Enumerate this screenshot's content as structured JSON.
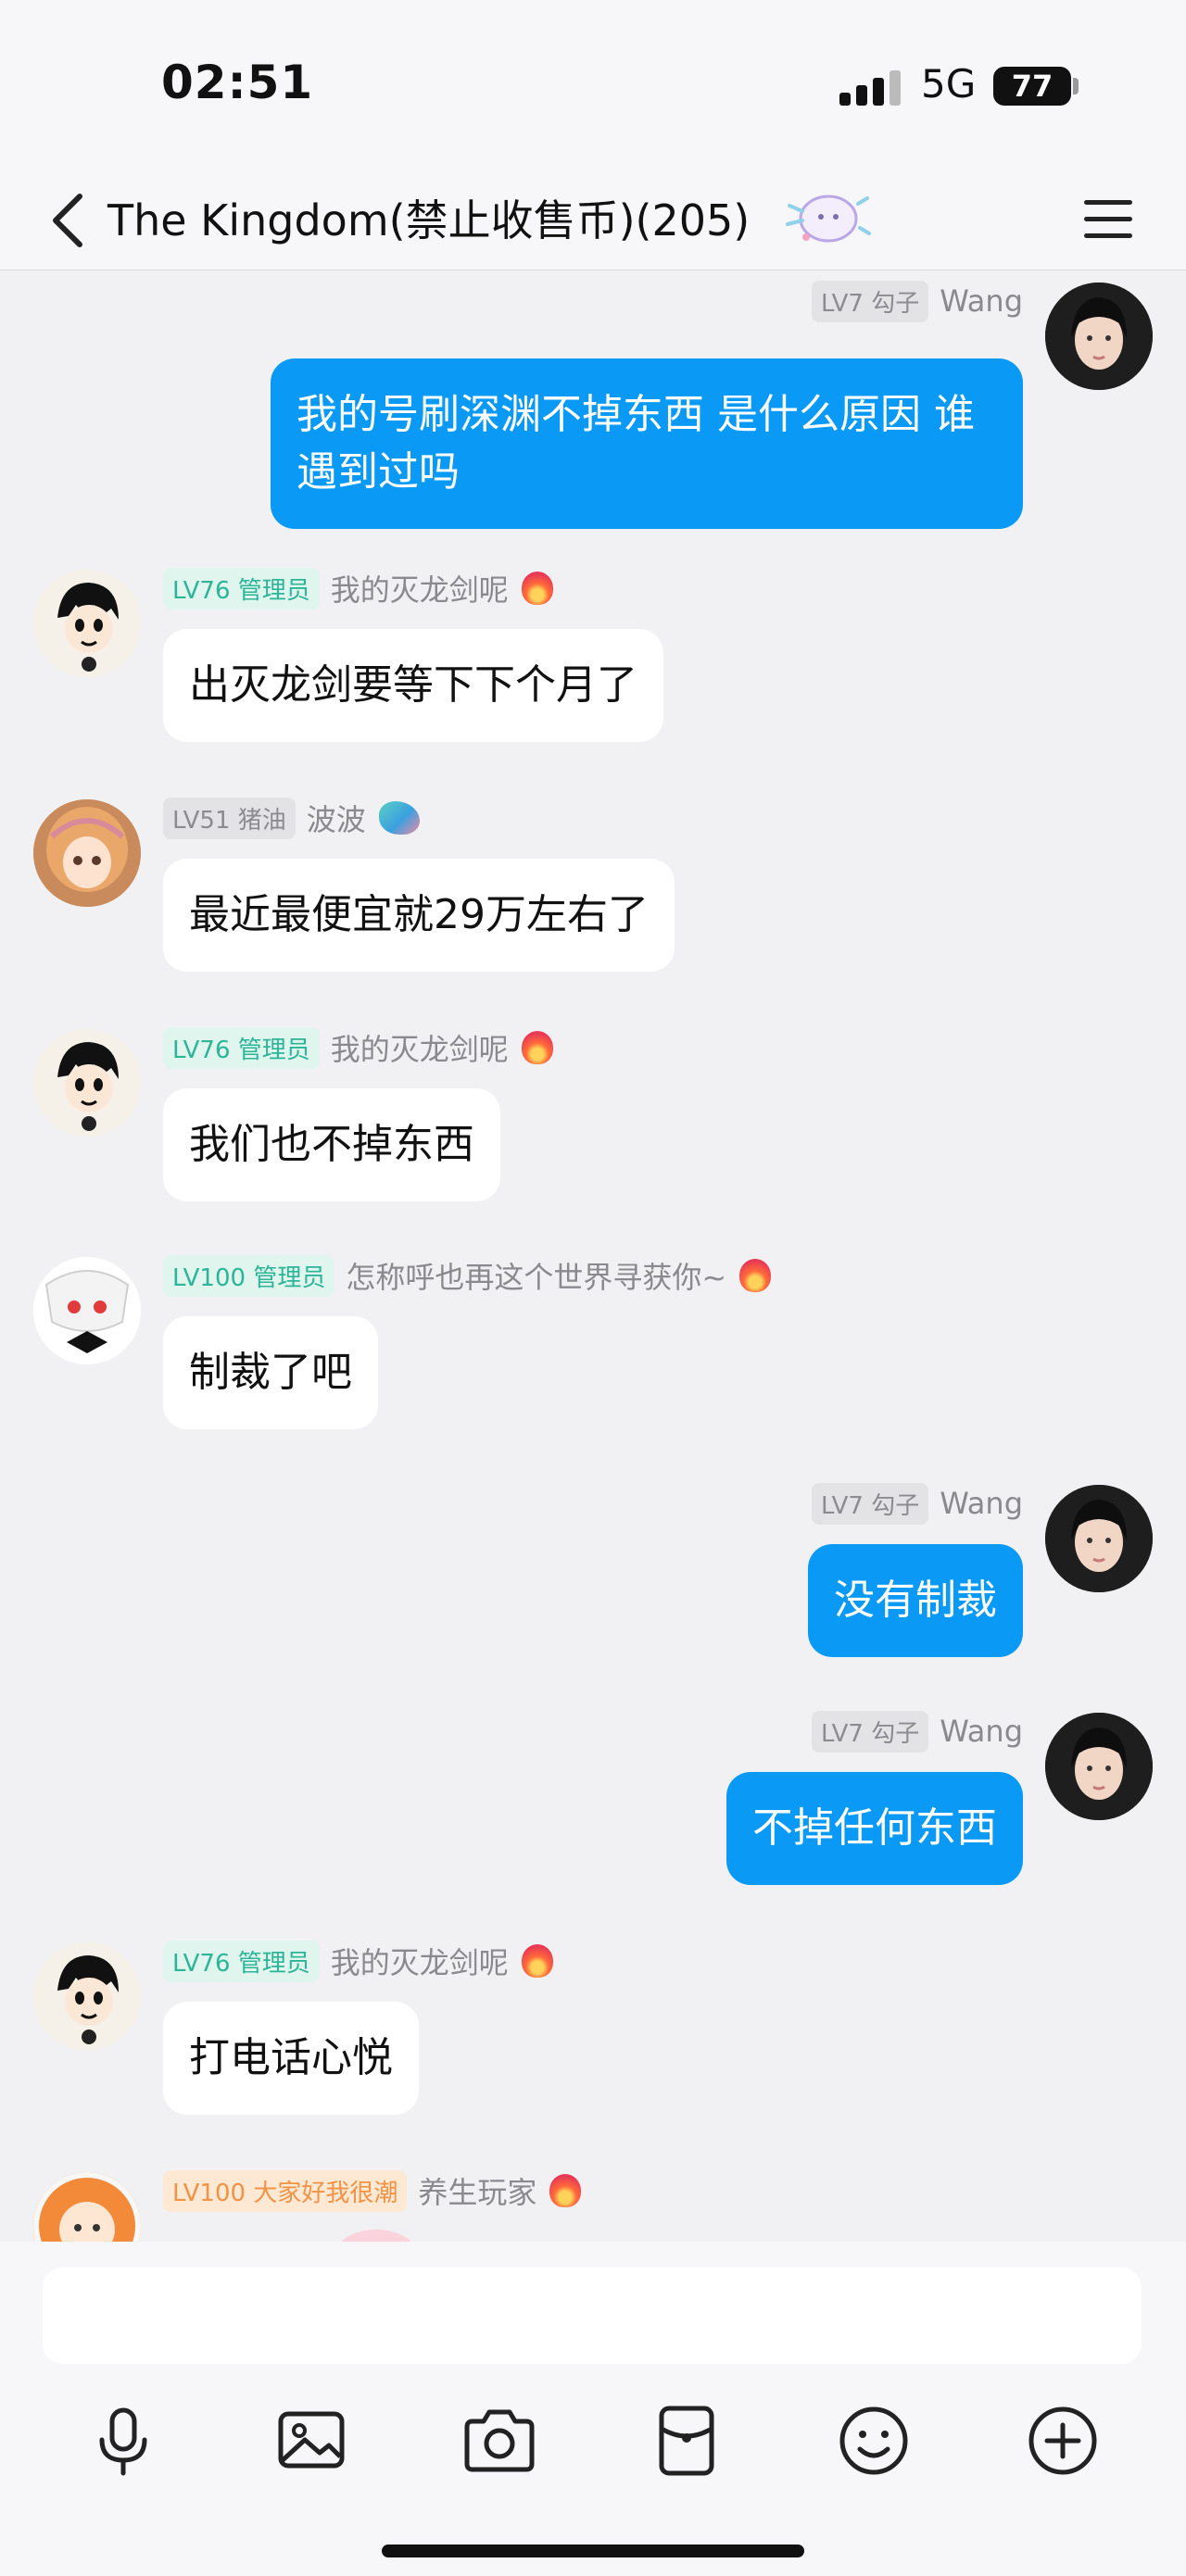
{
  "status_bar": {
    "time": "02:51",
    "network": "5G",
    "battery": "77"
  },
  "header": {
    "title": "The Kingdom(禁止收售币)(205)"
  },
  "messages": [
    {
      "side": "right",
      "level": "LV7",
      "tag": "勾子",
      "nick": "Wang",
      "text": "我的号刷深渊不掉东西 是什么原因 谁遇到过吗"
    },
    {
      "side": "left",
      "level": "LV76",
      "tag": "管理员",
      "nick": "我的灭龙剑呢",
      "text": "出灭龙剑要等下下个月了"
    },
    {
      "side": "left",
      "level": "LV51",
      "tag": "猪油",
      "nick": "波波",
      "text": "最近最便宜就29万左右了"
    },
    {
      "side": "left",
      "level": "LV76",
      "tag": "管理员",
      "nick": "我的灭龙剑呢",
      "text": "我们也不掉东西"
    },
    {
      "side": "left",
      "level": "LV100",
      "tag": "管理员",
      "nick": "怎称呼也再这个世界寻获你~",
      "text": "制裁了吧"
    },
    {
      "side": "right",
      "level": "LV7",
      "tag": "勾子",
      "nick": "Wang",
      "text": "没有制裁"
    },
    {
      "side": "right",
      "level": "LV7",
      "tag": "勾子",
      "nick": "Wang",
      "text": "不掉任何东西"
    },
    {
      "side": "left",
      "level": "LV76",
      "tag": "管理员",
      "nick": "我的灭龙剑呢",
      "text": "打电话心悦"
    },
    {
      "side": "left",
      "level": "LV100",
      "tag": "大家好我很潮",
      "nick": "养生玩家",
      "text": ""
    }
  ],
  "input": {
    "placeholder": ""
  },
  "toolbar": [
    "microphone-icon",
    "image-icon",
    "camera-icon",
    "red-packet-icon",
    "emoji-icon",
    "plus-icon"
  ],
  "colors": {
    "outgoing_bubble": "#0a99f5",
    "incoming_bubble": "#ffffff",
    "admin_badge": "#2cb596",
    "background": "#f1f1f3"
  }
}
